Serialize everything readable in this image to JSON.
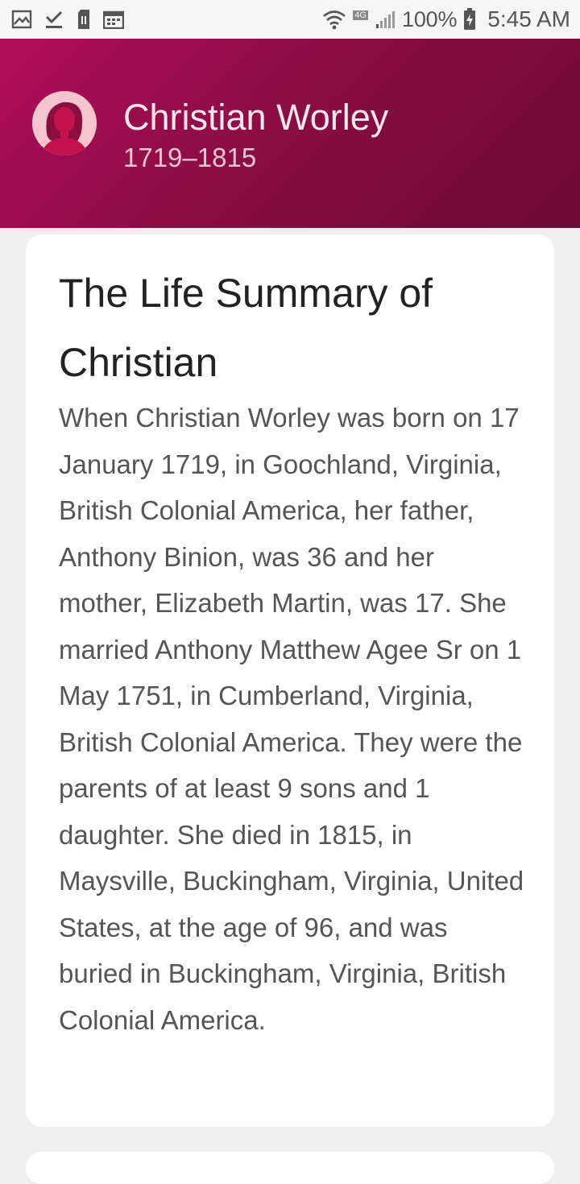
{
  "status_bar": {
    "battery": "100%",
    "time": "5:45 AM",
    "network_badge": "4G",
    "left_icons": [
      "gallery-icon",
      "download-done-icon",
      "sim-card-icon",
      "calendar-icon"
    ],
    "right_icons": [
      "wifi-icon",
      "signal-icon",
      "battery-charging-icon"
    ]
  },
  "header": {
    "name": "Christian Worley",
    "dates": "1719–1815",
    "colors": {
      "gradient_start": "#b00d5a",
      "gradient_end": "#6c0a32"
    }
  },
  "summary": {
    "title": "The Life Summary of Christian",
    "body": "When Christian Worley was born on 17 January 1719, in Goochland, Virginia, British Colonial America, her father, Anthony Binion, was 36 and her mother, Elizabeth Martin, was 17. She married Anthony Matthew Agee Sr on 1 May 1751, in Cumberland, Virginia, British Colonial America. They were the parents of at least 9 sons and 1 daughter. She died in 1815, in Maysville, Buckingham, Virginia, United States, at the age of 96, and was buried in Buckingham, Virginia, British Colonial America."
  }
}
